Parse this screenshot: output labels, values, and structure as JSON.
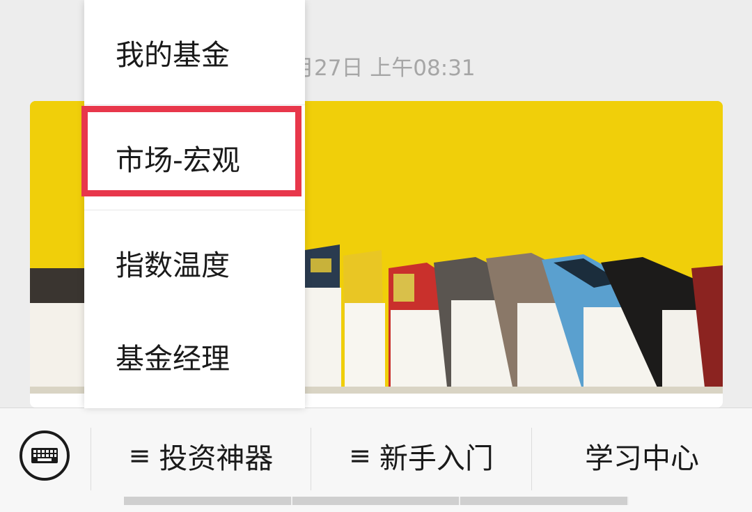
{
  "article": {
    "timestamp": "月27日 上午08:31"
  },
  "popup_menu": {
    "items": [
      {
        "label": "我的基金"
      },
      {
        "label": "市场-宏观",
        "highlighted": true
      },
      {
        "label": "指数温度"
      },
      {
        "label": "基金经理"
      }
    ],
    "highlight_color": "#e8374b"
  },
  "bottom_menu": {
    "keyboard_icon": "keyboard-icon",
    "menus": [
      {
        "label": "投资神器",
        "icon": "≡"
      },
      {
        "label": "新手入门",
        "icon": "≡"
      },
      {
        "label": "学习中心"
      }
    ]
  },
  "colors": {
    "cover_background": "#f0cf0a",
    "page_background": "#ededed"
  }
}
